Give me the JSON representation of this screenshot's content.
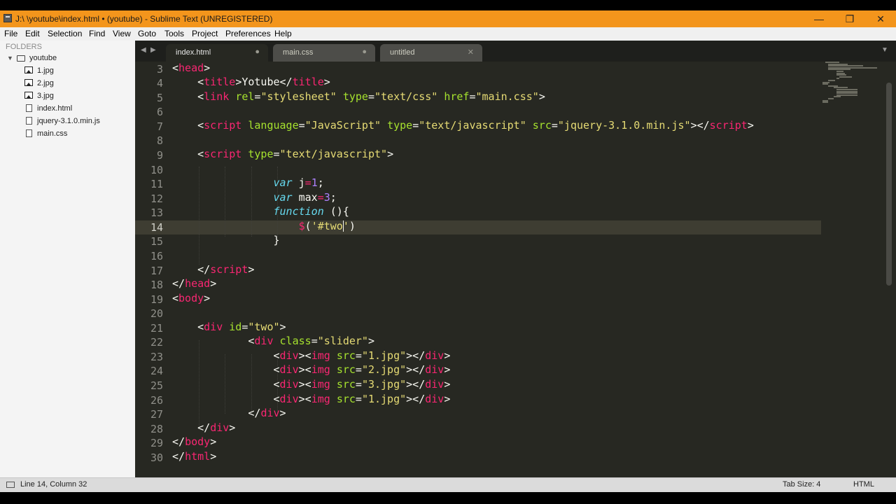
{
  "window": {
    "title": "J:\\ \\youtube\\index.html • (youtube) - Sublime Text (UNREGISTERED)",
    "minimize": "—",
    "restore": "❐",
    "close": "✕"
  },
  "menu": [
    "File",
    "Edit",
    "Selection",
    "Find",
    "View",
    "Goto",
    "Tools",
    "Project",
    "Preferences",
    "Help"
  ],
  "sidebar": {
    "heading": "FOLDERS",
    "folder": "youtube",
    "files": [
      "1.jpg",
      "2.jpg",
      "3.jpg",
      "index.html",
      "jquery-3.1.0.min.js",
      "main.css"
    ],
    "file_icons": [
      "image-icon",
      "image-icon",
      "image-icon",
      "document-icon",
      "document-icon",
      "document-icon"
    ]
  },
  "tabs": [
    {
      "label": "index.html",
      "state": "●",
      "active": true
    },
    {
      "label": "main.css",
      "state": "●",
      "active": false
    },
    {
      "label": "untitled",
      "state": "✕",
      "active": false
    }
  ],
  "tab_nav": {
    "prev": "◀",
    "next": "▶",
    "menu": "▼"
  },
  "editor": {
    "line_numbers": [
      "3",
      "4",
      "5",
      "6",
      "7",
      "8",
      "9",
      "10",
      "11",
      "12",
      "13",
      "14",
      "15",
      "16",
      "17",
      "18",
      "19",
      "20",
      "21",
      "22",
      "23",
      "24",
      "25",
      "26",
      "27",
      "28",
      "29",
      "30"
    ],
    "current_line": "14"
  },
  "status": {
    "position": "Line 14, Column 32",
    "tab_size": "Tab Size: 4",
    "syntax": "HTML"
  },
  "colors": {
    "titlebar": "#f3951c",
    "editor_bg": "#272822",
    "tag": "#f92672",
    "attr": "#a6e22e",
    "string": "#e6db74",
    "keyword": "#66d9ef",
    "number": "#ae81ff"
  }
}
